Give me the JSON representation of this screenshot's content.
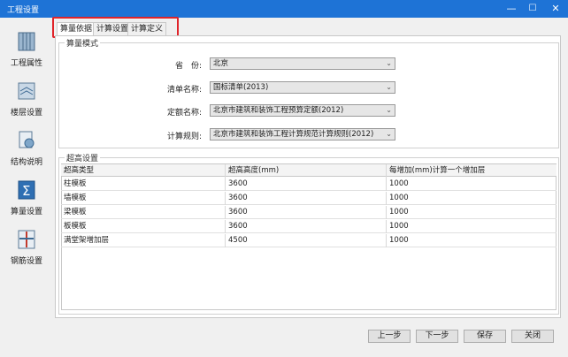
{
  "window": {
    "title": "工程设置",
    "minimize": "—",
    "maximize": "☐",
    "close": "✕"
  },
  "sidebar": {
    "items": [
      {
        "label": "工程属性"
      },
      {
        "label": "楼层设置"
      },
      {
        "label": "结构说明"
      },
      {
        "label": "算量设置"
      },
      {
        "label": "钢筋设置"
      }
    ]
  },
  "tabs": [
    {
      "label": "算量依据"
    },
    {
      "label": "计算设置"
    },
    {
      "label": "计算定义"
    }
  ],
  "calc_mode": {
    "group_title": "算量模式",
    "province_label": "省　份:",
    "province_value": "北京",
    "bill_label": "清单名称:",
    "bill_value": "国标清单(2013)",
    "quota_label": "定额名称:",
    "quota_value": "北京市建筑和装饰工程预算定额(2012)",
    "rule_label": "计算规则:",
    "rule_value": "北京市建筑和装饰工程计算规范计算规则(2012)"
  },
  "over_height": {
    "group_title": "超高设置",
    "columns": [
      "超高类型",
      "超高高度(mm)",
      "每增加(mm)计算一个增加层"
    ],
    "rows": [
      [
        "柱模板",
        "3600",
        "1000"
      ],
      [
        "墙模板",
        "3600",
        "1000"
      ],
      [
        "梁模板",
        "3600",
        "1000"
      ],
      [
        "板模板",
        "3600",
        "1000"
      ],
      [
        "满堂架增加层",
        "4500",
        "1000"
      ]
    ]
  },
  "buttons": {
    "prev": "上一步",
    "next": "下一步",
    "save": "保存",
    "close": "关闭"
  },
  "colors": {
    "titlebar": "#1e73d6",
    "highlight": "#e0242a"
  }
}
